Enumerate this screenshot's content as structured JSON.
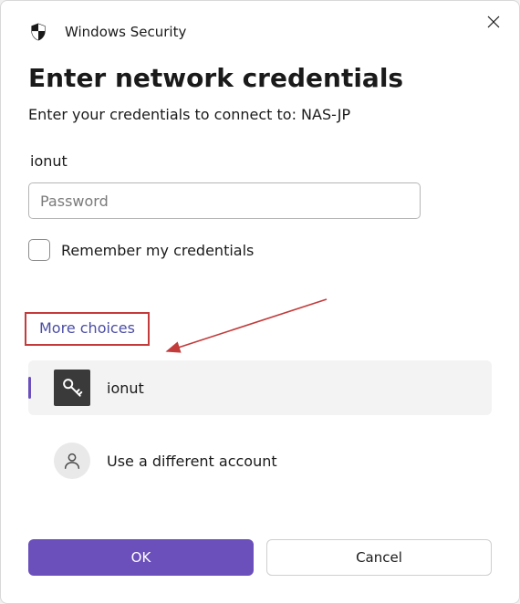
{
  "titlebar": {
    "app_name": "Windows Security"
  },
  "heading": "Enter network credentials",
  "subtext": "Enter your credentials to connect to: NAS-JP",
  "form": {
    "username": "ionut",
    "password_value": "",
    "password_placeholder": "Password",
    "remember_label": "Remember my credentials",
    "remember_checked": false
  },
  "more_choices_label": "More choices",
  "accounts": {
    "selected": {
      "icon": "key-icon",
      "label": "ionut"
    },
    "other": {
      "icon": "person-icon",
      "label": "Use a different account"
    }
  },
  "buttons": {
    "ok": "OK",
    "cancel": "Cancel"
  },
  "colors": {
    "accent": "#6b4fbb",
    "annotation": "#c33b3b"
  }
}
